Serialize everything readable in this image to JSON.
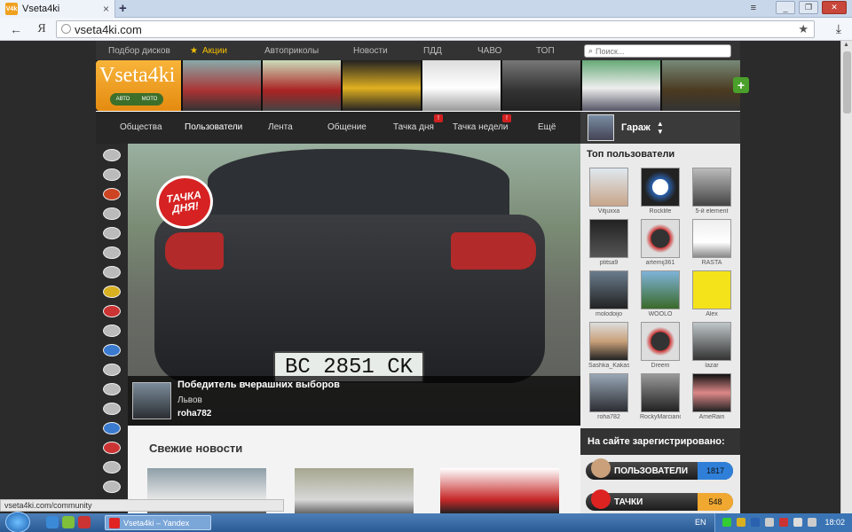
{
  "browser": {
    "tab_title": "Vseta4ki",
    "favicon_text": "V4k",
    "url": "vseta4ki.com",
    "nav_back": "←",
    "nav_yandex": "Я",
    "status_url": "vseta4ki.com/community"
  },
  "site": {
    "topnav": [
      {
        "label": "Подбор дисков"
      },
      {
        "label": "Акции"
      },
      {
        "label": "Автоприколы"
      },
      {
        "label": "Новости"
      },
      {
        "label": "ПДД"
      },
      {
        "label": "ЧАВО"
      },
      {
        "label": "ТОП"
      }
    ],
    "search_placeholder": "Поиск...",
    "logo_text": "Vseta4ki",
    "logo_sub_left": "АВТО",
    "logo_sub_right": "МОТО",
    "banner_plus": "+",
    "mainnav": [
      {
        "label": "Общества"
      },
      {
        "label": "Пользователи"
      },
      {
        "label": "Лента"
      },
      {
        "label": "Общение"
      },
      {
        "label": "Тачка дня",
        "badge": "!"
      },
      {
        "label": "Тачка недели",
        "badge": "!"
      },
      {
        "label": "Ещё"
      }
    ],
    "garage_label": "Гараж",
    "hero": {
      "day_badge": "ТАЧКА ДНЯ!",
      "plate": "BC 2851 CK",
      "caption_title": "Победитель вчерашних выборов",
      "caption_city": "Львов",
      "caption_user": "roha782"
    },
    "news_title": "Свежие новости",
    "top_users_title": "Топ пользователи",
    "top_users": [
      {
        "name": "Vitjuxxa"
      },
      {
        "name": "Rocklife"
      },
      {
        "name": "5-й element"
      },
      {
        "name": "ptitsa9"
      },
      {
        "name": "artemij361"
      },
      {
        "name": "RASTA"
      },
      {
        "name": "molodoijo"
      },
      {
        "name": "WOOLO"
      },
      {
        "name": "Alex"
      },
      {
        "name": "Sashka_Kakashka"
      },
      {
        "name": "Dreem"
      },
      {
        "name": "lazar"
      },
      {
        "name": "roha782"
      },
      {
        "name": "RockyMarciano"
      },
      {
        "name": "AmeRain"
      }
    ],
    "registered_title": "На сайте зарегистрировано:",
    "stats": [
      {
        "label": "ПОЛЬЗОВАТЕЛИ",
        "count": "1817",
        "color": "#2f7fd8"
      },
      {
        "label": "ТАЧКИ",
        "count": "548",
        "color": "#f0a830"
      }
    ]
  },
  "taskbar": {
    "task_label": "Vseta4ki – Yandex",
    "lang": "EN",
    "clock": "18:02"
  }
}
